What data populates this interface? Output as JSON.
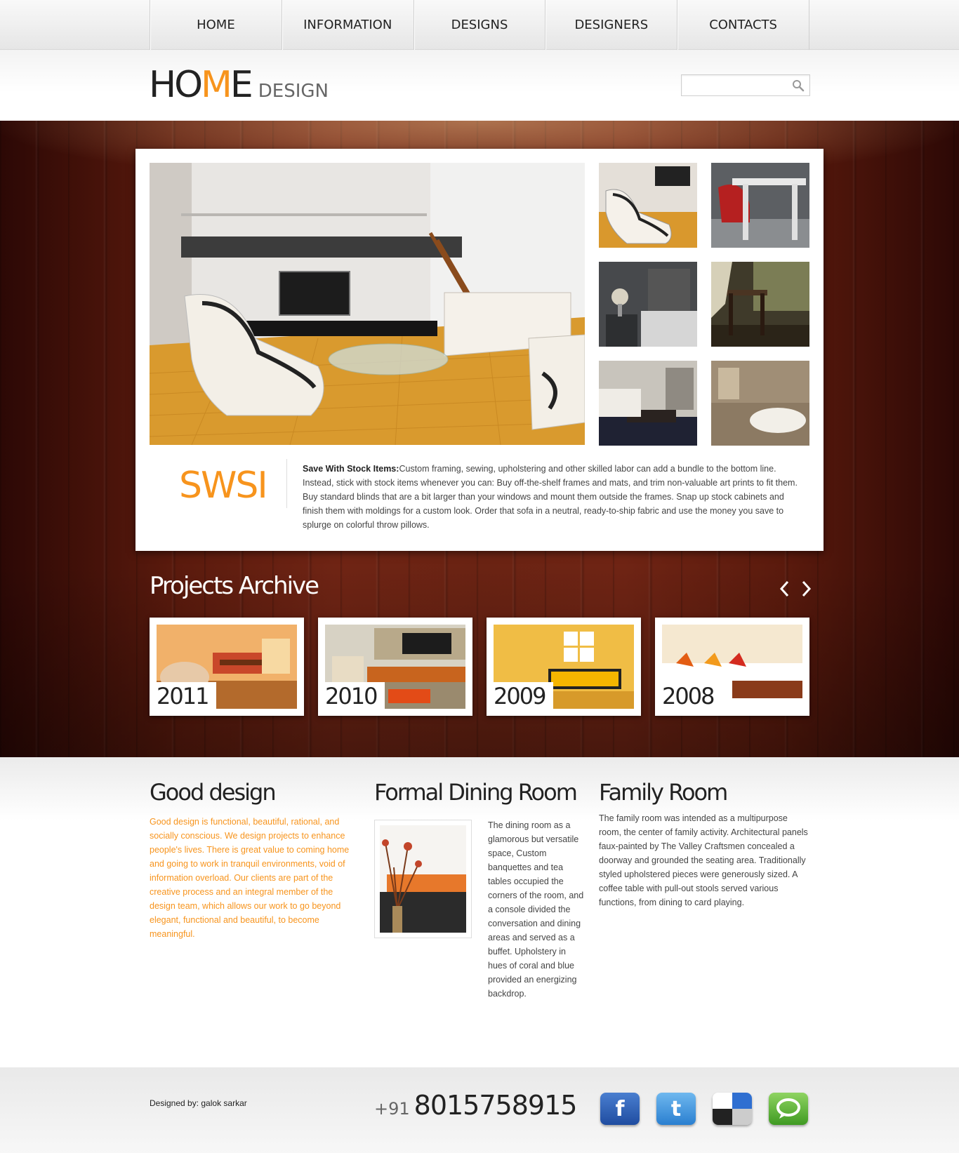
{
  "nav": {
    "items": [
      {
        "label": "HOME"
      },
      {
        "label": "INFORMATION"
      },
      {
        "label": "DESIGNS"
      },
      {
        "label": "DESIGNERS"
      },
      {
        "label": "CONTACTS"
      }
    ]
  },
  "header": {
    "logo_start": "HO",
    "logo_accent": "M",
    "logo_end": "E",
    "logo_sub": "DESIGN",
    "search_placeholder": ""
  },
  "feature": {
    "brand": "SWSI",
    "lead": "Save With Stock Items:",
    "body": "Custom framing, sewing, upholstering and other skilled labor can add a bundle to the bottom line. Instead, stick with stock items whenever you can: Buy off-the-shelf frames and mats, and trim non-valuable art prints to fit them. Buy standard blinds that are a bit larger than your windows and mount them outside the frames. Snap up stock cabinets and finish them with moldings for a custom look. Order that sofa in a neutral, ready-to-ship fabric and use the money you save to splurge on colorful throw pillows."
  },
  "archive": {
    "title": "Projects Archive",
    "projects": [
      {
        "year": "2011"
      },
      {
        "year": "2010"
      },
      {
        "year": "2009"
      },
      {
        "year": "2008"
      }
    ]
  },
  "columns": {
    "good": {
      "title": "Good design",
      "text": "Good design is functional, beautiful, rational, and socially conscious. We design projects to enhance people's lives. There is great value to coming home and going to work in tranquil environments, void of information overload. Our clients are part of the creative process and an integral member of the design team, which allows our work to go beyond elegant, functional and beautiful, to become meaningful."
    },
    "dining": {
      "title": "Formal Dining Room",
      "text": "The dining room as a glamorous but versatile space, Custom banquettes and tea tables occupied the corners of the room, and a console divided the conversation and dining areas and served as a buffet. Upholstery in hues of coral and blue provided an energizing backdrop."
    },
    "family": {
      "title": "Family Room",
      "text": "The family room was intended as a multipurpose room, the center of family activity. Architectural panels faux-painted by The Valley Craftsmen concealed a doorway and grounded the seating area. Traditionally styled upholstered pieces were generously sized. A coffee table with pull-out stools served various functions, from dining to card playing."
    }
  },
  "footer": {
    "credit": "Designed by: galok sarkar",
    "country_code": "+91",
    "phone": "8015758915"
  },
  "colors": {
    "accent": "#f7941d",
    "wood": "#6a2313",
    "facebook": "#2b5aa8",
    "twitter": "#3a86d4",
    "delicious": "#333333",
    "chat": "#5ab033"
  },
  "icons": [
    "search-icon",
    "arrow-left-icon",
    "arrow-right-icon",
    "facebook-icon",
    "twitter-icon",
    "delicious-icon",
    "chat-icon"
  ]
}
